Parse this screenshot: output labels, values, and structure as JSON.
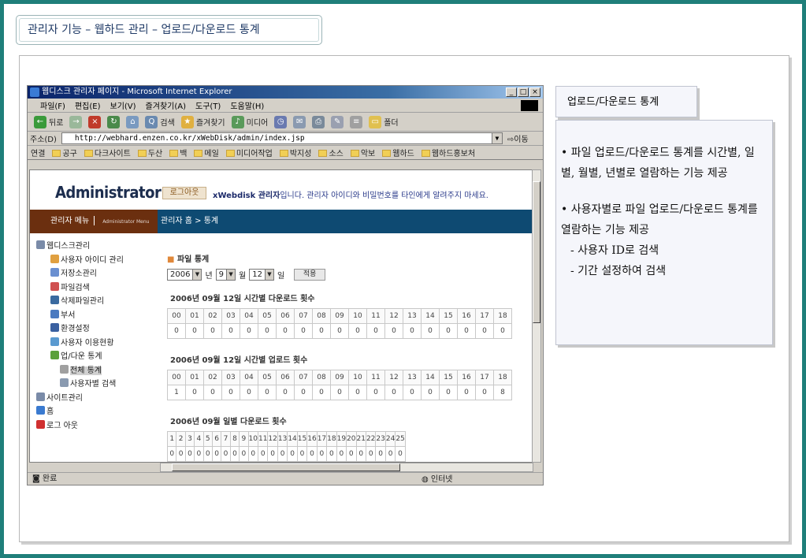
{
  "page_title": "관리자 기능 – 웹하드 관리 – 업로드/다운로드 통계",
  "ie": {
    "window_title": "웹디스크 관리자 페이지 - Microsoft Internet Explorer",
    "menu": [
      "파일(F)",
      "편집(E)",
      "보기(V)",
      "즐겨찾기(A)",
      "도구(T)",
      "도움말(H)"
    ],
    "toolbar": [
      "뒤로",
      "검색",
      "즐겨찾기",
      "미디어",
      "폴더"
    ],
    "address_label": "주소(D)",
    "address_url": "http://webhard.enzen.co.kr/xWebDisk/admin/index.jsp",
    "go_label": "이동",
    "links_label": "연결",
    "links": [
      "공구",
      "다크사이트",
      "두산",
      "백",
      "메일",
      "미디어작업",
      "박지성",
      "소스",
      "악보",
      "웹하드",
      "웹하드홍보처"
    ],
    "status": "완료",
    "status_zone": "인터넷"
  },
  "admin": {
    "logo": "Administrator",
    "menu_title": "관리자 메뉴",
    "menu_sub": "Administrator Menu",
    "logout": "로그아웃",
    "notice_bold": "xWebdisk 관리자",
    "notice_text": "입니다. 관리자 아이디와 비밀번호를 타인에게 알려주지 마세요.",
    "breadcrumb": "관리자 홈 > 통계",
    "tree": [
      {
        "label": "웹디스크관리",
        "indent": 0,
        "color": "#7a8ba8"
      },
      {
        "label": "사용자 아이디 관리",
        "indent": 1,
        "color": "#e0a040"
      },
      {
        "label": "저장소관리",
        "indent": 1,
        "color": "#6a8fd0"
      },
      {
        "label": "파일검색",
        "indent": 1,
        "color": "#d05050"
      },
      {
        "label": "삭제파일관리",
        "indent": 1,
        "color": "#3a6aa0"
      },
      {
        "label": "부서",
        "indent": 1,
        "color": "#4a7ac0"
      },
      {
        "label": "환경설정",
        "indent": 1,
        "color": "#3a60a0"
      },
      {
        "label": "사용자 이용현황",
        "indent": 1,
        "color": "#5a9ad0"
      },
      {
        "label": "업/다운 통계",
        "indent": 1,
        "color": "#5aa03a"
      },
      {
        "label": "전체 통계",
        "indent": 2,
        "color": "#a0a0a0",
        "selected": true
      },
      {
        "label": "사용자별 검색",
        "indent": 2,
        "color": "#8a9ab0"
      },
      {
        "label": "사이트관리",
        "indent": 0,
        "color": "#7a8ba8"
      },
      {
        "label": "홈",
        "indent": 0,
        "color": "#3a7ad0"
      },
      {
        "label": "로그 아웃",
        "indent": 0,
        "color": "#d03030"
      }
    ],
    "section_title": "파일 통계",
    "filter": {
      "year": "2006",
      "year_unit": "년",
      "month": "9",
      "month_unit": "월",
      "day": "12",
      "day_unit": "일",
      "apply": "적용"
    },
    "tables": [
      {
        "caption": "2006년 09월 12일 시간별 다운로드 횟수",
        "head": [
          "00",
          "01",
          "02",
          "03",
          "04",
          "05",
          "06",
          "07",
          "08",
          "09",
          "10",
          "11",
          "12",
          "13",
          "14",
          "15",
          "16",
          "17",
          "18"
        ],
        "values": [
          "0",
          "0",
          "0",
          "0",
          "0",
          "0",
          "0",
          "0",
          "0",
          "0",
          "0",
          "0",
          "0",
          "0",
          "0",
          "0",
          "0",
          "0",
          "0"
        ]
      },
      {
        "caption": "2006년 09월 12일 시간별 업로드 횟수",
        "head": [
          "00",
          "01",
          "02",
          "03",
          "04",
          "05",
          "06",
          "07",
          "08",
          "09",
          "10",
          "11",
          "12",
          "13",
          "14",
          "15",
          "16",
          "17",
          "18"
        ],
        "values": [
          "1",
          "0",
          "0",
          "0",
          "0",
          "0",
          "0",
          "0",
          "0",
          "0",
          "0",
          "0",
          "0",
          "0",
          "0",
          "0",
          "0",
          "0",
          "8"
        ]
      },
      {
        "caption": "2006년 09월 일별 다운로드 횟수",
        "head": [
          "1",
          "2",
          "3",
          "4",
          "5",
          "6",
          "7",
          "8",
          "9",
          "10",
          "11",
          "12",
          "13",
          "14",
          "15",
          "16",
          "17",
          "18",
          "19",
          "20",
          "21",
          "22",
          "23",
          "24",
          "25"
        ],
        "values": [
          "0",
          "0",
          "0",
          "0",
          "0",
          "0",
          "0",
          "0",
          "0",
          "0",
          "0",
          "0",
          "0",
          "0",
          "0",
          "0",
          "0",
          "0",
          "0",
          "0",
          "0",
          "0",
          "0",
          "0",
          "0"
        ]
      }
    ]
  },
  "description": {
    "heading": "업로드/다운로드 통계",
    "items": [
      "• 파일 업로드/다운로드 통계를 시간별, 일별, 월별, 년별로 열람하는 기능 제공",
      "• 사용자별로 파일 업로드/다운로드 통계를 열람하는 기능 제공"
    ],
    "sub_items": [
      "- 사용자 ID로 검색",
      "- 기간 설정하여 검색"
    ]
  }
}
